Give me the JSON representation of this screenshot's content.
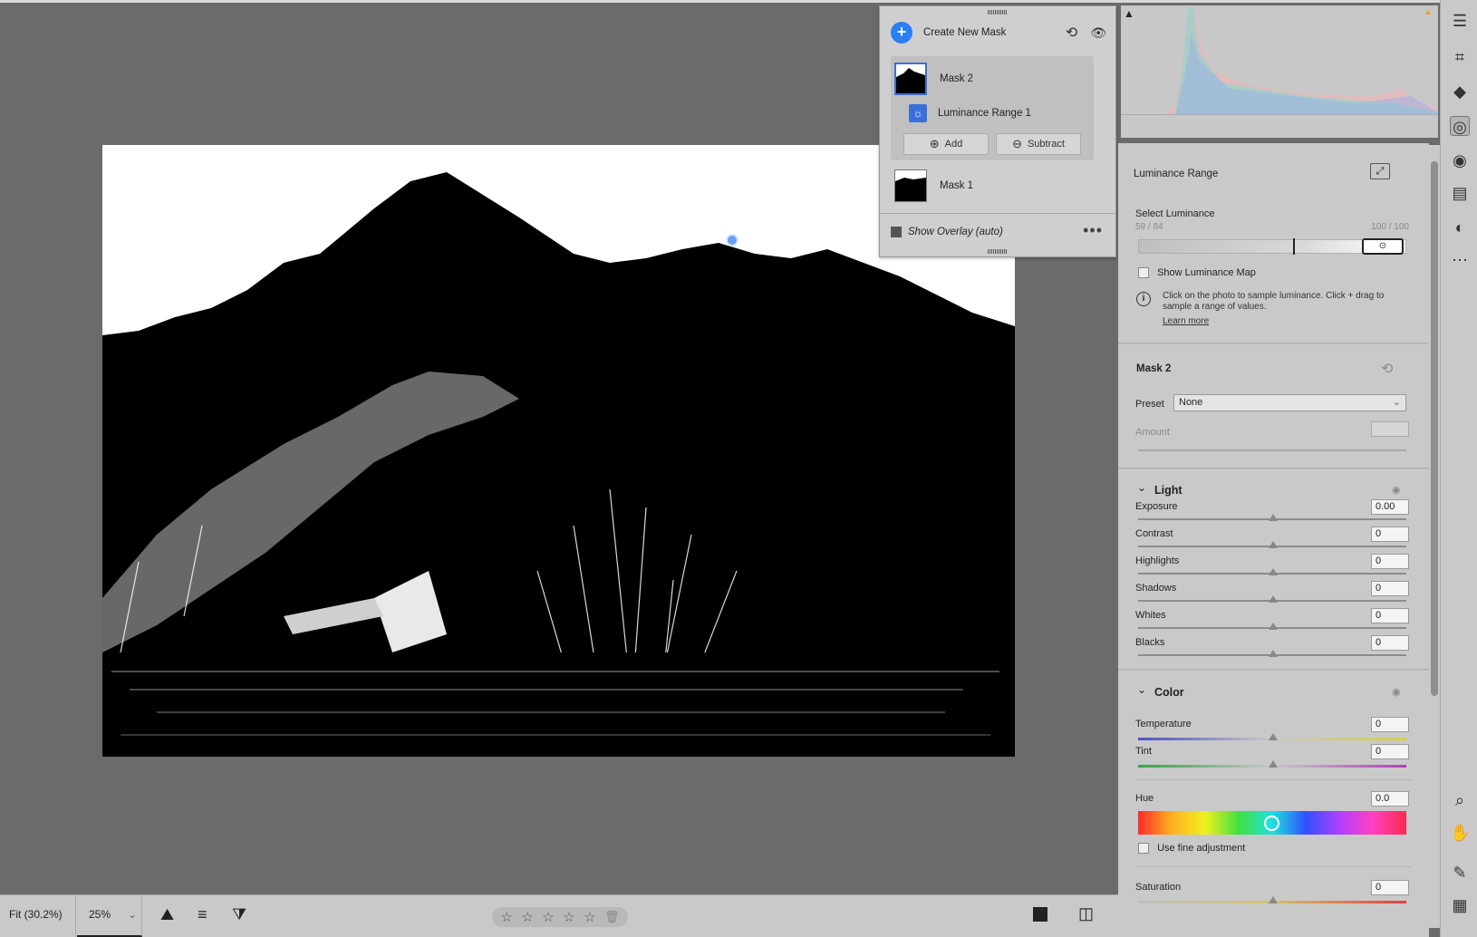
{
  "mask_panel": {
    "create_new_mask": "Create New Mask",
    "masks": [
      {
        "name": "Mask 2",
        "selected": true
      },
      {
        "name": "Luminance Range 1"
      },
      {
        "name": "Mask 1"
      }
    ],
    "add_label": "Add",
    "subtract_label": "Subtract",
    "show_overlay": "Show Overlay (auto)",
    "show_overlay_checked": true
  },
  "luminance": {
    "section_title": "Luminance Range",
    "select_label": "Select Luminance",
    "range_left": "59 / 84",
    "range_right": "100 / 100",
    "range_low": 59,
    "range_high": 84,
    "show_map_label": "Show Luminance Map",
    "info_text": "Click on the photo to sample luminance. Click + drag to sample a range of values.",
    "learn_more": "Learn more"
  },
  "mask2": {
    "title": "Mask 2",
    "preset_label": "Preset",
    "preset_value": "None",
    "amount_label": "Amount"
  },
  "light": {
    "title": "Light",
    "sliders": [
      {
        "label": "Exposure",
        "value": "0.00"
      },
      {
        "label": "Contrast",
        "value": "0"
      },
      {
        "label": "Highlights",
        "value": "0"
      },
      {
        "label": "Shadows",
        "value": "0"
      },
      {
        "label": "Whites",
        "value": "0"
      },
      {
        "label": "Blacks",
        "value": "0"
      }
    ]
  },
  "color": {
    "title": "Color",
    "temperature_label": "Temperature",
    "temperature_value": "0",
    "tint_label": "Tint",
    "tint_value": "0",
    "hue_label": "Hue",
    "hue_value": "0.0",
    "fine_adjust_label": "Use fine adjustment",
    "saturation_label": "Saturation",
    "saturation_value": "0"
  },
  "bottom_bar": {
    "fit_label": "Fit (30.2%)",
    "zoom_value": "25%",
    "rating_stars": 5
  },
  "icons": {
    "toolbar": [
      "sliders-icon",
      "crop-icon",
      "eraser-icon",
      "mask-icon",
      "redeye-icon",
      "layers-icon",
      "presets-icon",
      "more-icon",
      "zoom-icon",
      "hand-icon",
      "eyedropper-icon",
      "grid-icon"
    ],
    "accent": "#2a7ff2"
  }
}
